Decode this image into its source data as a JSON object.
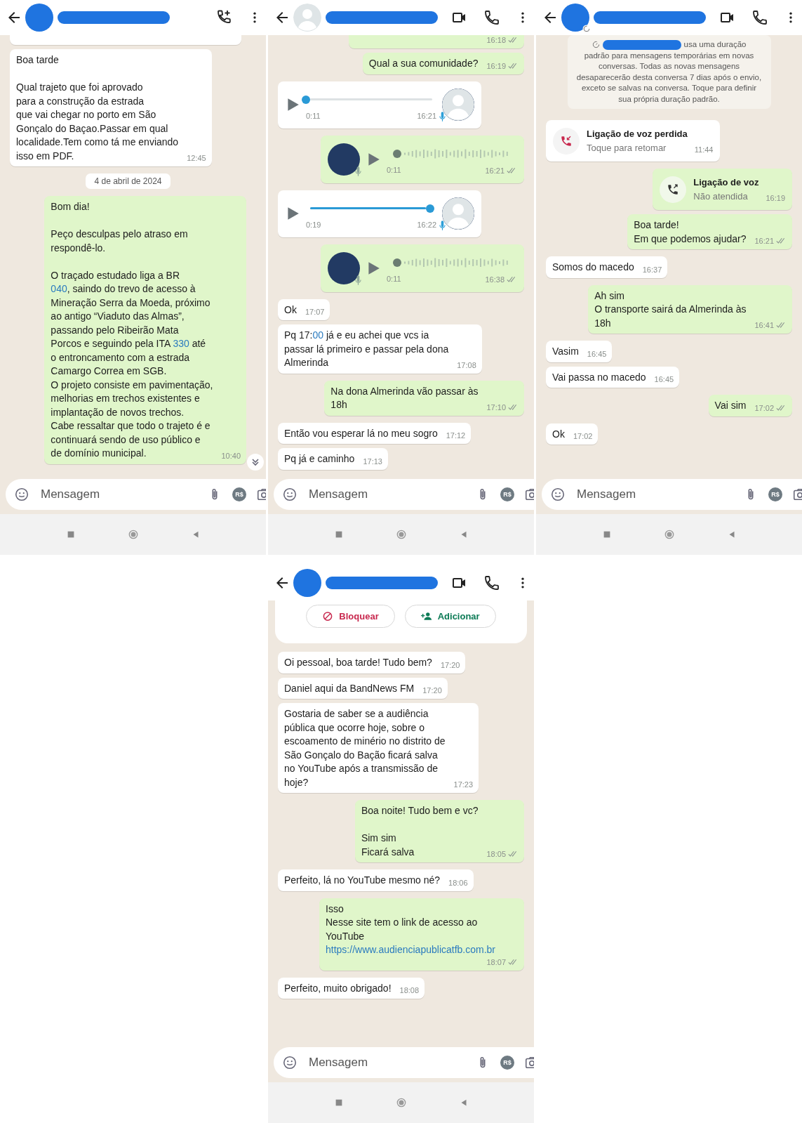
{
  "panels": [
    {
      "header": {
        "kind": "group",
        "avatar": {
          "kind": "redacted"
        },
        "disappearing": false
      },
      "scroll_down": true,
      "messages": [
        {
          "kind": "partial",
          "outgoing": false
        },
        {
          "kind": "text",
          "outgoing": false,
          "text": "Boa tarde\n\nQual trajeto que foi aprovado\npara a construção da estrada\nque vai chegar no porto em São\nGonçalo do Baçao.Passar em qual\nlocalidade.Tem como tá me enviando\nisso em PDF.",
          "time": "12:45"
        },
        {
          "kind": "date",
          "text": "4 de abril de 2024"
        },
        {
          "kind": "text",
          "outgoing": true,
          "segments": [
            {
              "text": "Bom dia!\n\nPeço desculpas pelo atraso em\nrespondê-lo.\n\nO traçado estudado liga a BR\n",
              "link": false
            },
            {
              "text": "040",
              "link": true
            },
            {
              "text": ", saindo do trevo de acesso à\nMineração Serra da Moeda, próximo\nao antigo “Viaduto das Almas”,\npassando pelo Ribeirão Mata\nPorcos e seguindo pela ITA ",
              "link": false
            },
            {
              "text": "330",
              "link": true
            },
            {
              "text": " até\no entroncamento com a estrada\nCamargo Correa em SGB.\nO projeto consiste em pavimentação,\nmelhorias em trechos existentes e\nimplantação de novos trechos.\nCabe ressaltar que todo o trajeto é e\ncontinuará sendo de uso público e\nde domínio municipal.",
              "link": false
            }
          ],
          "time": "10:40"
        }
      ],
      "composer": {
        "placeholder": "Mensagem",
        "payment_label": "R$"
      }
    },
    {
      "header": {
        "kind": "contact",
        "avatar": {
          "kind": "default"
        },
        "disappearing": false
      },
      "messages": [
        {
          "kind": "partial",
          "outgoing": true,
          "time": "16:18",
          "read": false
        },
        {
          "kind": "text",
          "outgoing": true,
          "text": "Qual a sua comunidade?",
          "time": "16:19",
          "read": false
        },
        {
          "kind": "audio",
          "outgoing": false,
          "level": 0,
          "duration": "0:11",
          "time": "16:21"
        },
        {
          "kind": "audio",
          "outgoing": true,
          "duration": "0:11",
          "time": "16:21",
          "read": false
        },
        {
          "kind": "audio",
          "outgoing": false,
          "level": 0.95,
          "duration": "0:19",
          "time": "16:22"
        },
        {
          "kind": "audio",
          "outgoing": true,
          "duration": "0:11",
          "time": "16:38",
          "read": false
        },
        {
          "kind": "text",
          "outgoing": false,
          "text": "Ok",
          "time": "17:07"
        },
        {
          "kind": "text",
          "outgoing": false,
          "segments": [
            {
              "text": "Pq 17:",
              "link": false
            },
            {
              "text": "00",
              "link": true
            },
            {
              "text": " já e eu achei que vcs ia\npassar lá primeiro e passar pela dona\nAlmerinda",
              "link": false
            }
          ],
          "time": "17:08"
        },
        {
          "kind": "text",
          "outgoing": true,
          "text": "Na dona Almerinda vão passar às\n18h",
          "time": "17:10",
          "read": false
        },
        {
          "kind": "text",
          "outgoing": false,
          "text": "Então vou esperar lá no meu sogro",
          "time": "17:12"
        },
        {
          "kind": "text",
          "outgoing": false,
          "text": "Pq já e caminho",
          "time": "17:13"
        }
      ],
      "composer": {
        "placeholder": "Mensagem",
        "payment_label": "R$"
      }
    },
    {
      "header": {
        "kind": "contact",
        "avatar": {
          "kind": "redacted"
        },
        "disappearing": true
      },
      "messages": [
        {
          "kind": "system",
          "lead": "usa uma duração",
          "text": "padrão para mensagens temporárias em novas conversas. Todas as novas mensagens desaparecerão desta conversa 7 dias após o envio, exceto se salvas na conversa. Toque para definir sua própria duração padrão."
        },
        {
          "kind": "call",
          "outgoing": false,
          "missed": true,
          "title": "Ligação de voz perdida",
          "subtitle": "Toque para retomar",
          "time": "11:44"
        },
        {
          "kind": "call",
          "outgoing": true,
          "missed": false,
          "title": "Ligação de voz",
          "subtitle": "Não atendida",
          "time": "16:19"
        },
        {
          "kind": "text",
          "outgoing": true,
          "text": "Boa tarde!\nEm que podemos ajudar?",
          "time": "16:21",
          "read": false
        },
        {
          "kind": "text",
          "outgoing": false,
          "text": "Somos do macedo",
          "time": "16:37"
        },
        {
          "kind": "text",
          "outgoing": true,
          "text": "Ah sim\nO transporte sairá da Almerinda às\n18h",
          "time": "16:41",
          "read": false
        },
        {
          "kind": "text",
          "outgoing": false,
          "text": "Vasim",
          "time": "16:45"
        },
        {
          "kind": "text",
          "outgoing": false,
          "text": "Vai passa no macedo",
          "time": "16:45"
        },
        {
          "kind": "text",
          "outgoing": true,
          "text": "Vai sim",
          "time": "17:02",
          "read": false
        },
        {
          "kind": "text",
          "outgoing": false,
          "text": "Ok",
          "time": "17:02"
        }
      ],
      "composer": {
        "placeholder": "Mensagem",
        "payment_label": "R$"
      }
    },
    {
      "header": {
        "kind": "contact",
        "avatar": {
          "kind": "redacted"
        },
        "disappearing": false
      },
      "messages": [
        {
          "kind": "actions",
          "buttons": [
            {
              "kind": "block",
              "label": "Bloquear"
            },
            {
              "kind": "add",
              "label": "Adicionar"
            }
          ]
        },
        {
          "kind": "text",
          "outgoing": false,
          "text": "Oi pessoal, boa tarde! Tudo bem?",
          "time": "17:20"
        },
        {
          "kind": "text",
          "outgoing": false,
          "text": "Daniel aqui da BandNews FM",
          "time": "17:20"
        },
        {
          "kind": "text",
          "outgoing": false,
          "text": "Gostaria de saber se a audiência\npública que ocorre hoje, sobre o\nescoamento de minério no distrito de\nSão Gonçalo do Bação ficará salva\nno YouTube após a transmissão de\nhoje?",
          "time": "17:23"
        },
        {
          "kind": "text",
          "outgoing": true,
          "text": "Boa noite! Tudo bem e vc?\n\nSim sim\nFicará salva",
          "time": "18:05",
          "read": false
        },
        {
          "kind": "text",
          "outgoing": false,
          "text": "Perfeito, lá no YouTube mesmo né?",
          "time": "18:06"
        },
        {
          "kind": "text",
          "outgoing": true,
          "segments": [
            {
              "text": "Isso\nNesse site tem o link de acesso ao\nYouTube\n",
              "link": false
            },
            {
              "text": "https://www.audienciapublicatfb.com.br",
              "link": true
            }
          ],
          "time": "18:07",
          "read": false
        },
        {
          "kind": "text",
          "outgoing": false,
          "text": "Perfeito, muito obrigado!",
          "time": "18:08"
        }
      ],
      "composer": {
        "placeholder": "Mensagem",
        "payment_label": "R$"
      }
    }
  ]
}
